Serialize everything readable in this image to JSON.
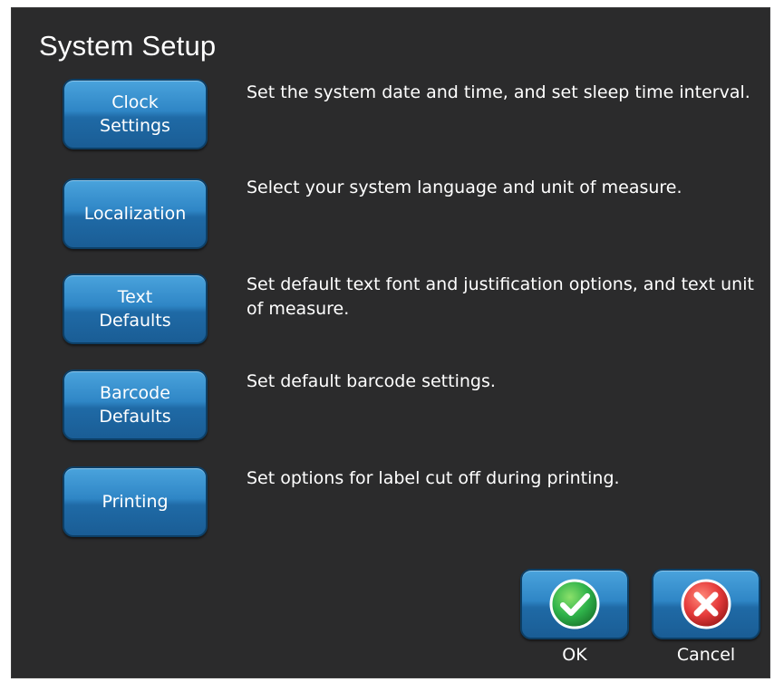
{
  "window": {
    "title": "System Setup"
  },
  "options": [
    {
      "label": "Clock\nSettings",
      "description": "Set the system date and time, and set sleep time interval."
    },
    {
      "label": "Localization",
      "description": "Select your system language and unit of measure."
    },
    {
      "label": "Text\nDefaults",
      "description": "Set default text font and justification options, and text unit of measure."
    },
    {
      "label": "Barcode\nDefaults",
      "description": "Set default barcode settings."
    },
    {
      "label": "Printing",
      "description": "Set options for label cut off during printing."
    }
  ],
  "actions": {
    "ok": {
      "label": "OK",
      "icon": "check-icon",
      "color": "#2fb34a"
    },
    "cancel": {
      "label": "Cancel",
      "icon": "close-icon",
      "color": "#e53b3b"
    }
  },
  "colors": {
    "panel_background": "#2b2b2c",
    "button_blue": "#2f86c6",
    "text": "#ffffff"
  }
}
